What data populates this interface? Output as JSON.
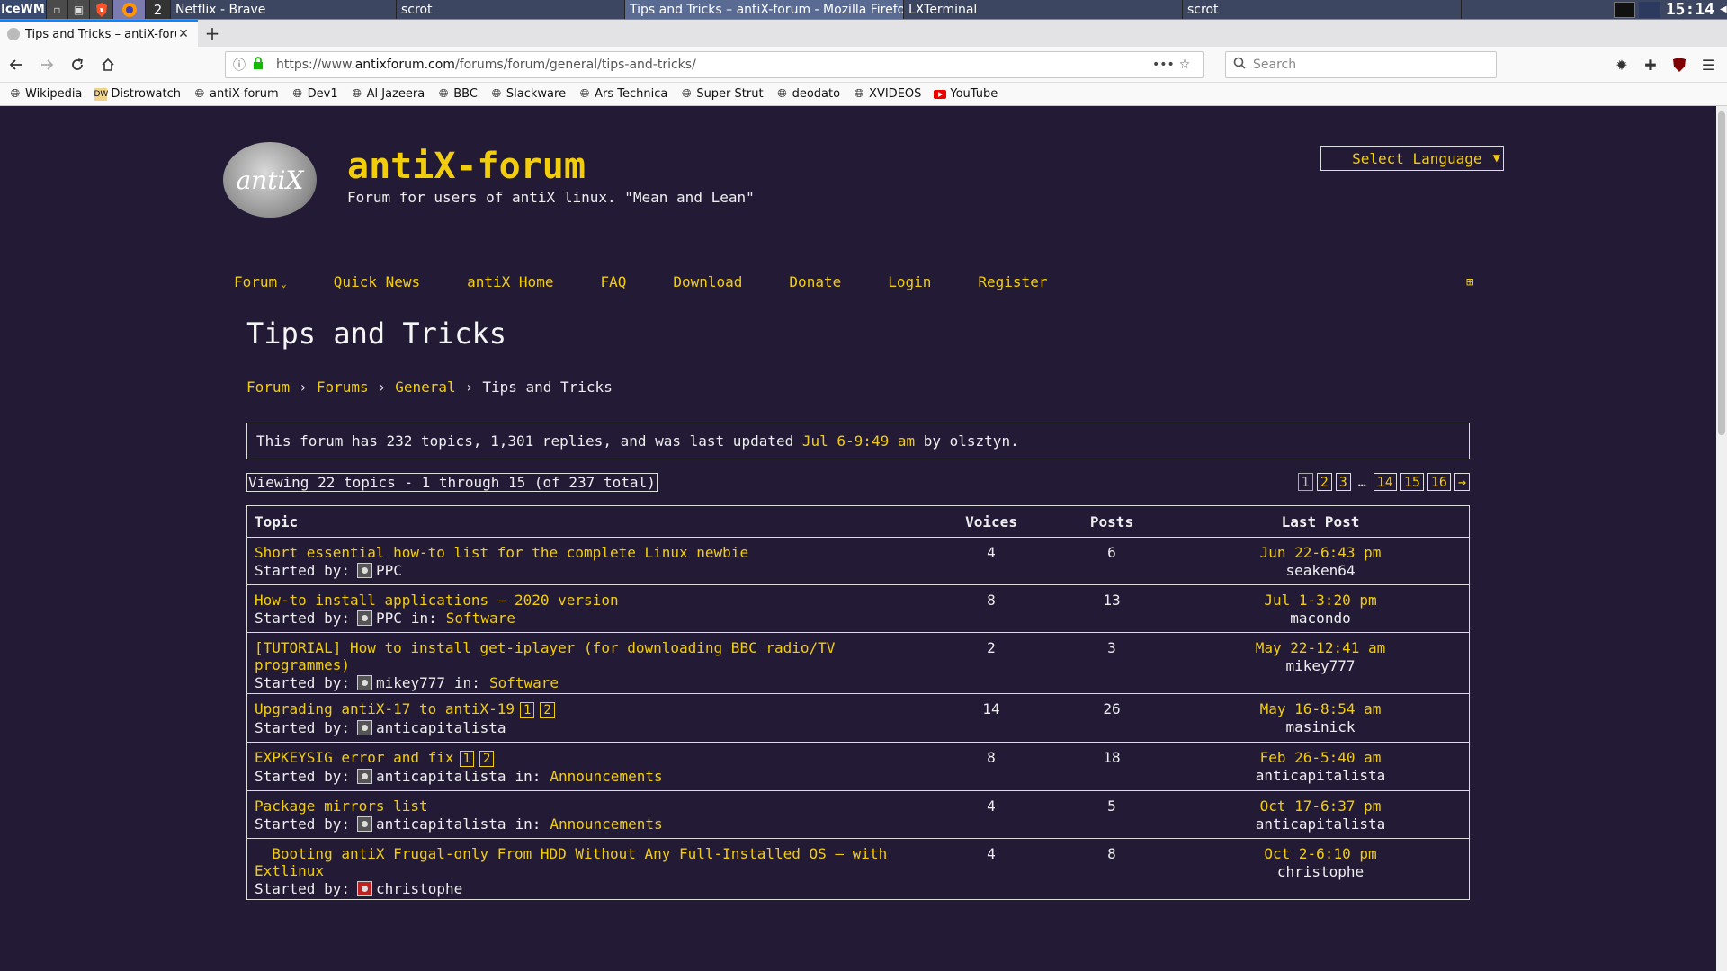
{
  "taskbar": {
    "start_label": "IceWM",
    "workspace": "2",
    "tasks": [
      "Netflix - Brave",
      "scrot",
      "Tips and Tricks – antiX-forum - Mozilla Firefox",
      "LXTerminal",
      "scrot"
    ],
    "clock": "15:14"
  },
  "browser": {
    "tab_title": "Tips and Tricks – antiX-forum",
    "url_prefix": "https://www.",
    "url_domain": "antixforum.com",
    "url_path": "/forums/forum/general/tips-and-tricks/",
    "search_placeholder": "Search",
    "bookmarks": [
      "Wikipedia",
      "Distrowatch",
      "antiX-forum",
      "Dev1",
      "Al Jazeera",
      "BBC",
      "Slackware",
      "Ars Technica",
      "Super Strut",
      "deodato",
      "XVIDEOS",
      "YouTube"
    ]
  },
  "site": {
    "logo_text": "antiX",
    "title": "antiX-forum",
    "description": "Forum for users of antiX linux. \"Mean and Lean\"",
    "language_select": "Select Language",
    "nav": [
      "Forum",
      "Quick News",
      "antiX Home",
      "FAQ",
      "Download",
      "Donate",
      "Login",
      "Register"
    ]
  },
  "page": {
    "title": "Tips and Tricks",
    "breadcrumb": [
      "Forum",
      "Forums",
      "General",
      "Tips and Tricks"
    ],
    "info_prefix": "This forum has 232 topics, 1,301 replies, and was last updated ",
    "info_date": "Jul 6-9:49 am",
    "info_suffix": " by olsztyn.",
    "viewing": "Viewing 22 topics - 1 through 15 (of 237 total)",
    "pages": [
      "1",
      "2",
      "3",
      "…",
      "14",
      "15",
      "16",
      "→"
    ]
  },
  "table": {
    "headers": [
      "Topic",
      "Voices",
      "Posts",
      "Last Post"
    ],
    "started_by": "Started by:",
    "in_label": "in:",
    "rows": [
      {
        "title": "Short essential how-to list for the complete Linux newbie",
        "author": "PPC",
        "forum": "",
        "voices": "4",
        "posts": "6",
        "date": "Jun 22-6:43 pm",
        "last_user": "seaken64"
      },
      {
        "title": "How-to install applications – 2020 version",
        "author": "PPC",
        "forum": "Software",
        "voices": "8",
        "posts": "13",
        "date": "Jul 1-3:20 pm",
        "last_user": "macondo"
      },
      {
        "title": "[TUTORIAL] How to install get-iplayer (for downloading BBC radio/TV",
        "title2": "programmes)",
        "author": "mikey777",
        "forum": "Software",
        "voices": "2",
        "posts": "3",
        "date": "May 22-12:41 am",
        "last_user": "mikey777"
      },
      {
        "title": "Upgrading antiX-17 to antiX-19",
        "pages": [
          "1",
          "2"
        ],
        "author": "anticapitalista",
        "forum": "",
        "voices": "14",
        "posts": "26",
        "date": "May 16-8:54 am",
        "last_user": "masinick"
      },
      {
        "title": "EXPKEYSIG error and fix",
        "pages": [
          "1",
          "2"
        ],
        "author": "anticapitalista",
        "forum": "Announcements",
        "voices": "8",
        "posts": "18",
        "date": "Feb 26-5:40 am",
        "last_user": "anticapitalista"
      },
      {
        "title": "Package mirrors list",
        "author": "anticapitalista",
        "forum": "Announcements",
        "voices": "4",
        "posts": "5",
        "date": "Oct 17-6:37 pm",
        "last_user": "anticapitalista"
      },
      {
        "title": "  Booting antiX Frugal-only From HDD Without Any Full-Installed OS – with",
        "title2": "Extlinux",
        "author": "christophe",
        "forum": "",
        "voices": "4",
        "posts": "8",
        "date": "Oct 2-6:10 pm",
        "last_user": "christophe"
      }
    ]
  },
  "colors": {
    "background": "#231a36",
    "accent": "#f2cd0e",
    "text": "#ececec"
  },
  "icons": [
    "back-icon",
    "forward-icon",
    "reload-icon",
    "home-icon",
    "lock-icon",
    "star-icon",
    "search-icon",
    "gear-icon",
    "extension-icon",
    "ublock-icon",
    "menu-icon",
    "grid-icon"
  ]
}
